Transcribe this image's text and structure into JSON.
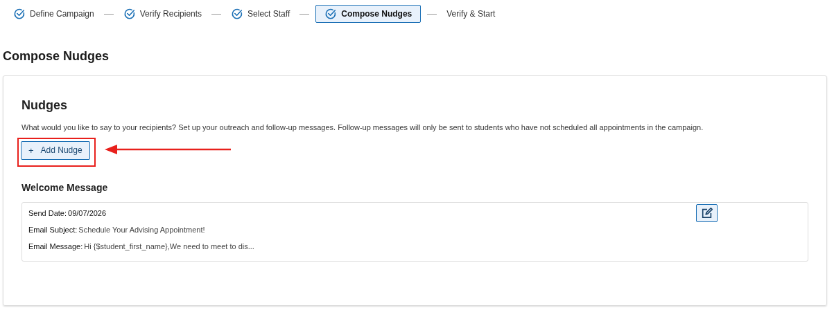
{
  "steps": [
    {
      "label": "Define Campaign",
      "completed": true,
      "selected": false
    },
    {
      "label": "Verify Recipients",
      "completed": true,
      "selected": false
    },
    {
      "label": "Select Staff",
      "completed": true,
      "selected": false
    },
    {
      "label": "Compose Nudges",
      "completed": true,
      "selected": true
    },
    {
      "label": "Verify & Start",
      "completed": false,
      "selected": false
    }
  ],
  "page_title": "Compose Nudges",
  "nudges": {
    "title": "Nudges",
    "description": "What would you like to say to your recipients? Set up your outreach and follow-up messages. Follow-up messages will only be sent to students who have not scheduled all appointments in the campaign.",
    "add_button": {
      "icon": "+",
      "label": "Add Nudge",
      "highlighted": true
    }
  },
  "welcome": {
    "title": "Welcome Message",
    "fields": [
      {
        "label": "Send Date:",
        "value": "09/07/2026",
        "emphasized": true
      },
      {
        "label": "Email Subject:",
        "value": "Schedule Your Advising Appointment!",
        "emphasized": false
      },
      {
        "label": "Email Message:",
        "value": "Hi {$student_first_name},We need to meet to dis...",
        "emphasized": false
      }
    ]
  }
}
